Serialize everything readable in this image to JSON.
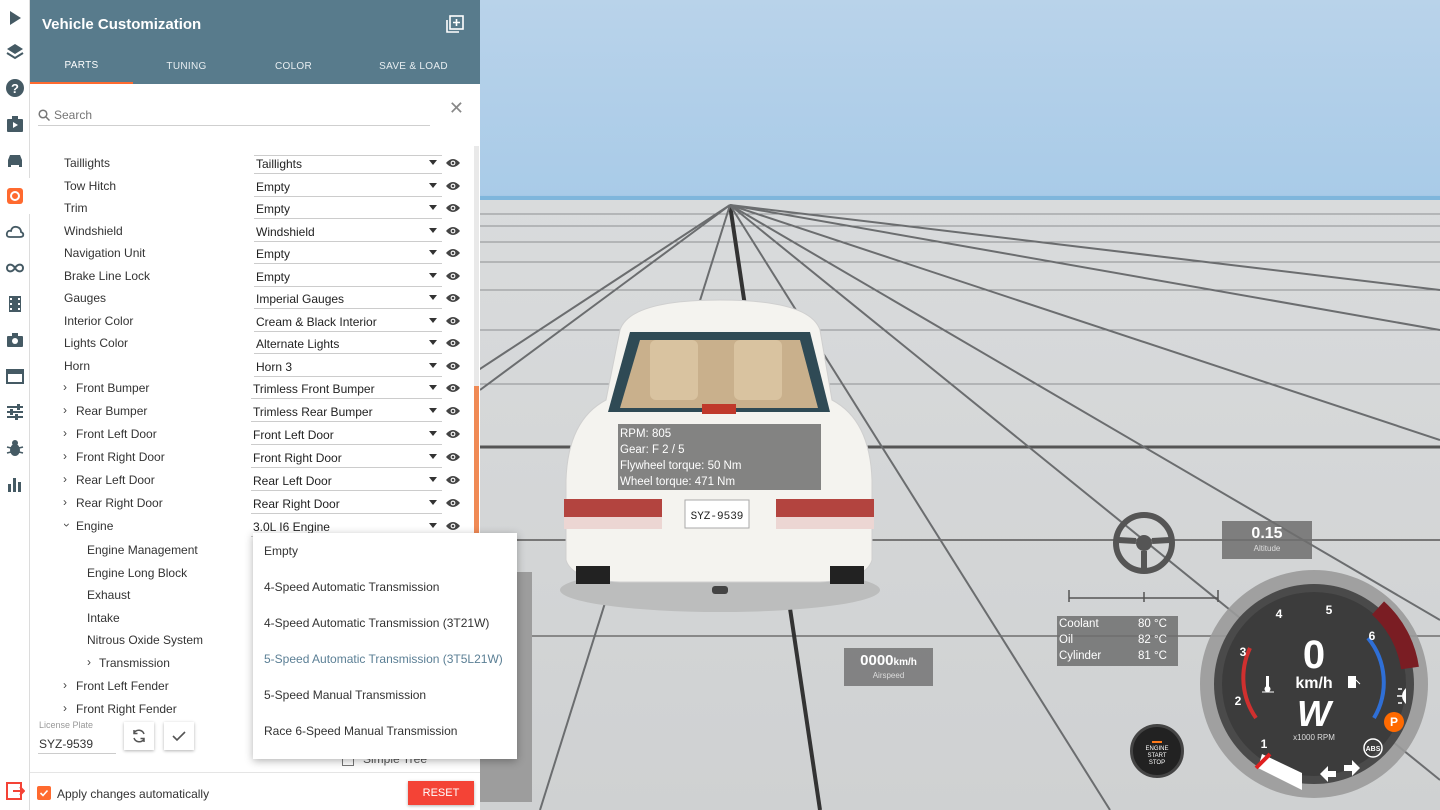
{
  "panel": {
    "title": "Vehicle Customization",
    "tabs": [
      {
        "label": "PARTS",
        "active": true
      },
      {
        "label": "TUNING",
        "active": false
      },
      {
        "label": "COLOR",
        "active": false
      },
      {
        "label": "SAVE & LOAD",
        "active": false
      }
    ],
    "search_placeholder": "Search"
  },
  "parts": [
    {
      "name": "Taillights",
      "value": "Taillights"
    },
    {
      "name": "Tow Hitch",
      "value": "Empty"
    },
    {
      "name": "Trim",
      "value": "Empty"
    },
    {
      "name": "Windshield",
      "value": "Windshield"
    },
    {
      "name": "Navigation Unit",
      "value": "Empty"
    },
    {
      "name": "Brake Line Lock",
      "value": "Empty"
    },
    {
      "name": "Gauges",
      "value": "Imperial Gauges"
    },
    {
      "name": "Interior Color",
      "value": "Cream & Black Interior"
    },
    {
      "name": "Lights Color",
      "value": "Alternate Lights"
    },
    {
      "name": "Horn",
      "value": "Horn 3"
    },
    {
      "name": "Front Bumper",
      "value": "Trimless Front Bumper"
    },
    {
      "name": "Rear Bumper",
      "value": "Trimless Rear Bumper"
    },
    {
      "name": "Front Left Door",
      "value": "Front Left Door"
    },
    {
      "name": "Front Right Door",
      "value": "Front Right Door"
    },
    {
      "name": "Rear Left Door",
      "value": "Rear Left Door"
    },
    {
      "name": "Rear Right Door",
      "value": "Rear Right Door"
    },
    {
      "name": "Engine",
      "value": "3.0L I6 Engine"
    },
    {
      "name": "Engine Management"
    },
    {
      "name": "Engine Long Block"
    },
    {
      "name": "Exhaust"
    },
    {
      "name": "Intake"
    },
    {
      "name": "Nitrous Oxide System"
    },
    {
      "name": "Transmission"
    },
    {
      "name": "Front Left Fender"
    },
    {
      "name": "Front Right Fender"
    }
  ],
  "dropdown": {
    "options": [
      "Empty",
      "4-Speed Automatic Transmission",
      "4-Speed Automatic Transmission (3T21W)",
      "5-Speed Automatic Transmission (3T5L21W)",
      "5-Speed Manual Transmission",
      "Race 6-Speed Manual Transmission"
    ],
    "selected": "5-Speed Automatic Transmission (3T5L21W)"
  },
  "license": {
    "label": "License Plate",
    "value": "SYZ-9539"
  },
  "simple_tree": "Simple Tree",
  "footer": {
    "apply_label": "Apply changes automatically",
    "reset_label": "RESET"
  },
  "hud": {
    "debug": [
      "RPM: 805",
      "Gear: F 2 / 5",
      "Flywheel torque: 50 Nm",
      "Wheel torque: 471 Nm"
    ],
    "airspeed_value": "0000",
    "airspeed_unit": "km/h",
    "airspeed_label": "Airspeed",
    "altitude_value": "0.15",
    "altitude_label": "Altitude",
    "temps": [
      {
        "name": "Coolant",
        "value": "80 °C"
      },
      {
        "name": "Oil",
        "value": "82 °C"
      },
      {
        "name": "Cylinder",
        "value": "81 °C"
      }
    ],
    "engine_button": [
      "ENGINE",
      "START",
      "STOP"
    ],
    "gauge": {
      "speed": "0",
      "unit": "km/h",
      "gear": "W",
      "rpm_label": "x1000 RPM",
      "ticks": [
        "1",
        "2",
        "3",
        "4",
        "5",
        "6"
      ],
      "abs_label": "ABS",
      "parking_label": "P"
    },
    "license_plate_text": "SYZ-9539"
  },
  "colors": {
    "header": "#587b8c",
    "accent": "#ff6a2f",
    "reset": "#f44336"
  }
}
